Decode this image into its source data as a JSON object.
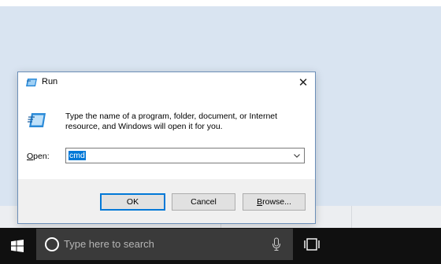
{
  "dialog": {
    "title": "Run",
    "description": "Type the name of a program, folder, document, or Internet resource, and Windows will open it for you.",
    "open_label_underlined": "O",
    "open_label_rest": "pen:",
    "input_value": "cmd",
    "buttons": {
      "ok": "OK",
      "cancel": "Cancel",
      "browse_underlined": "B",
      "browse_rest": "rowse..."
    },
    "close_glyph": "✕"
  },
  "taskbar": {
    "search_placeholder": "Type here to search"
  },
  "colors": {
    "selection": "#0078d7",
    "taskbar": "#101010",
    "desktop": "#d9e4f1"
  },
  "icons": [
    "run-app-icon",
    "close-icon",
    "chevron-down-icon",
    "windows-logo-icon",
    "cortana-icon",
    "microphone-icon",
    "task-view-icon"
  ]
}
